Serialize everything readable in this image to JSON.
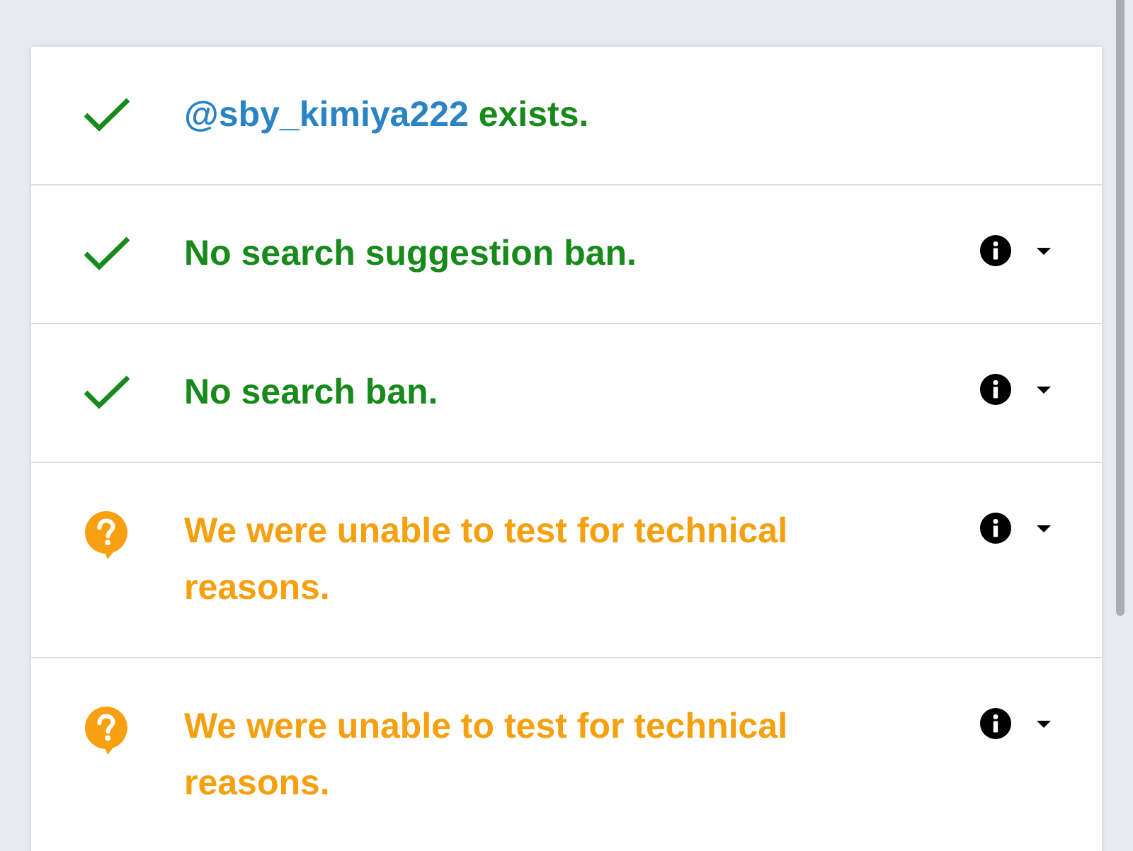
{
  "results": [
    {
      "kind": "pass",
      "username": "@sby_kimiya222",
      "text": "exists.",
      "details_toggle": false
    },
    {
      "kind": "pass",
      "text": "No search suggestion ban.",
      "details_toggle": true
    },
    {
      "kind": "pass",
      "text": "No search ban.",
      "details_toggle": true
    },
    {
      "kind": "unknown",
      "text": "We were unable to test for technical reasons.",
      "details_toggle": true
    },
    {
      "kind": "unknown",
      "text": "We were unable to test for technical reasons.",
      "details_toggle": true
    }
  ]
}
